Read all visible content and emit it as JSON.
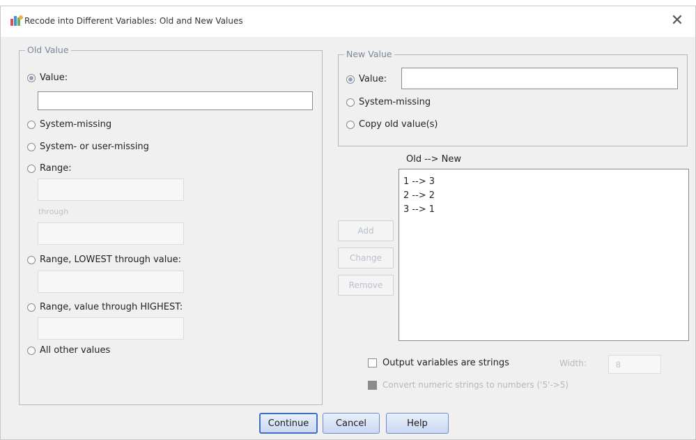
{
  "window": {
    "title": "Recode into Different Variables: Old and New Values",
    "close_glyph": "✕"
  },
  "old_value": {
    "legend": "Old Value",
    "value_label": "Value:",
    "value_input": "",
    "system_missing": "System-missing",
    "system_or_user_missing": "System- or user-missing",
    "range": "Range:",
    "through": "through",
    "range_lowest": "Range, LOWEST through value:",
    "range_highest": "Range, value through HIGHEST:",
    "all_other": "All other values"
  },
  "new_value": {
    "legend": "New Value",
    "value_label": "Value:",
    "value_input": "",
    "system_missing": "System-missing",
    "copy_old": "Copy old value(s)"
  },
  "mapping": {
    "header": "Old --> New",
    "items": [
      "1 --> 3",
      "2 --> 2",
      "3 --> 1"
    ]
  },
  "list_buttons": {
    "add": "Add",
    "change": "Change",
    "remove": "Remove"
  },
  "options": {
    "output_strings": "Output variables are strings",
    "width_label": "Width:",
    "width_value": "8",
    "convert_numeric": "Convert numeric strings to numbers ('5'->5)"
  },
  "footer": {
    "continue": "Continue",
    "cancel": "Cancel",
    "help": "Help"
  },
  "colors": {
    "button_border": "#6f8dc4",
    "legend_text": "#7a8796",
    "disabled_text": "#b8c0cc"
  }
}
